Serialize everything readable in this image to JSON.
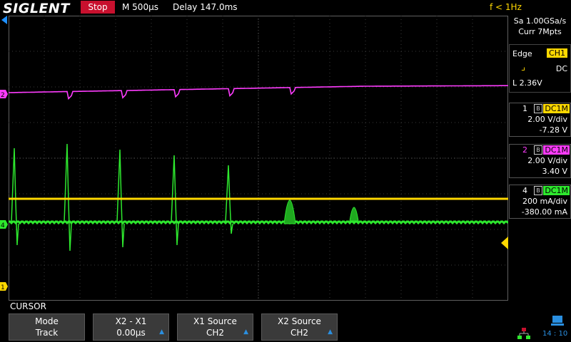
{
  "header": {
    "brand": "SIGLENT",
    "run_state": "Stop",
    "timebase": "M 500µs",
    "delay": "Delay 147.0ms",
    "trigger_freq": "f < 1Hz"
  },
  "acquisition": {
    "sample_rate": "Sa 1.00GSa/s",
    "memory_depth": "Curr 7Mpts"
  },
  "trigger": {
    "type": "Edge",
    "source": "CH1",
    "slope_icon": "rising-edge-icon",
    "coupling": "DC",
    "level": "L  2.36V"
  },
  "channels": [
    {
      "number": "1",
      "bw_icon": "B",
      "coupling": "DC1M",
      "scale": "2.00 V/div",
      "offset": "-7.28 V",
      "color": "#ffd800"
    },
    {
      "number": "2",
      "bw_icon": "B",
      "coupling": "DC1M",
      "scale": "2.00 V/div",
      "offset": "3.40 V",
      "color": "#ff3cff"
    },
    {
      "number": "4",
      "bw_icon": "B",
      "coupling": "DC1M",
      "scale": "200 mA/div",
      "offset": "-380.00 mA",
      "color": "#2ee82e"
    }
  ],
  "markers": {
    "ch1": "1",
    "ch2": "2",
    "ch4": "4"
  },
  "menu": {
    "title": "CURSOR",
    "softkeys": [
      {
        "label": "Mode",
        "value": "Track"
      },
      {
        "label": "X2 - X1",
        "value": "0.00µs"
      },
      {
        "label": "X1 Source",
        "value": "CH2"
      },
      {
        "label": "X2 Source",
        "value": "CH2"
      }
    ]
  },
  "status": {
    "time": "14 : 10"
  }
}
